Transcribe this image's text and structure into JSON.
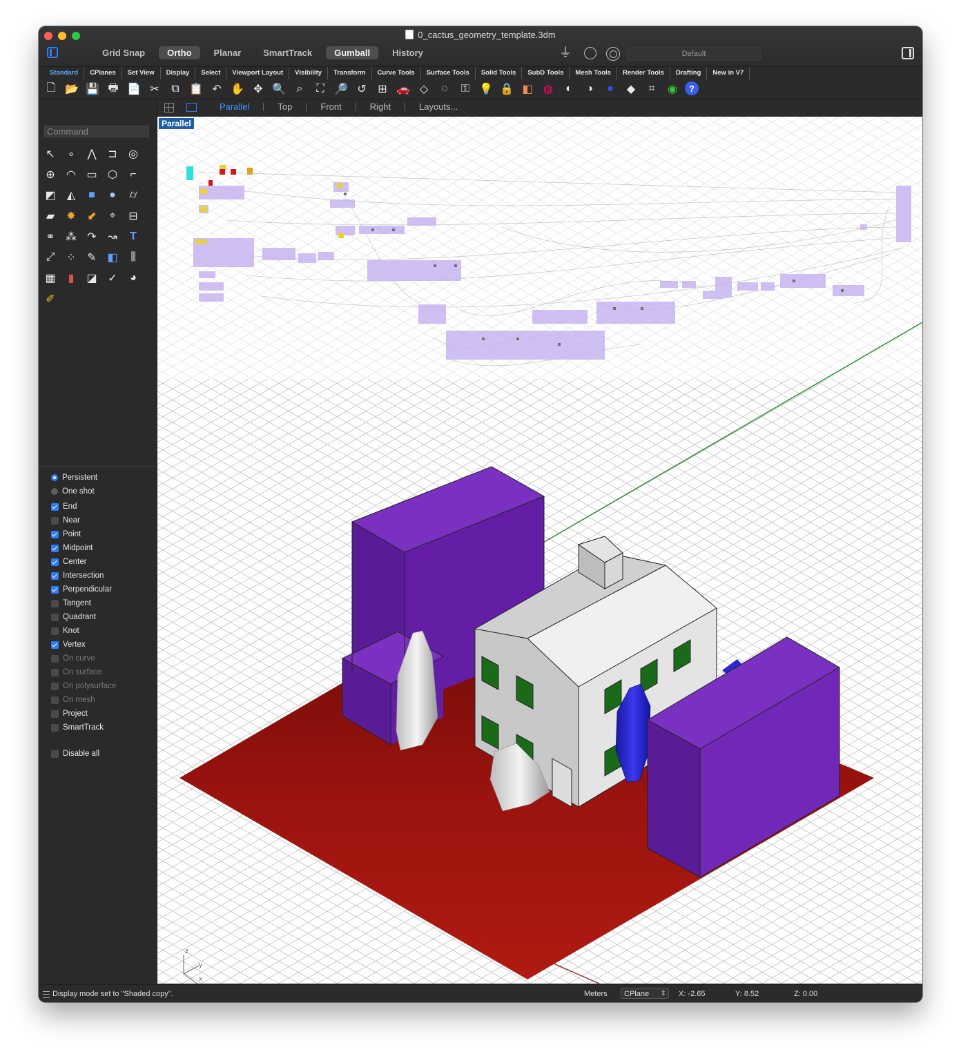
{
  "window": {
    "title": "0_cactus_geometry_template.3dm"
  },
  "modes": [
    {
      "label": "Grid Snap",
      "on": false
    },
    {
      "label": "Ortho",
      "on": true
    },
    {
      "label": "Planar",
      "on": false
    },
    {
      "label": "SmartTrack",
      "on": false
    },
    {
      "label": "Gumball",
      "on": true
    },
    {
      "label": "History",
      "on": false
    }
  ],
  "layer": {
    "current": "Default"
  },
  "tabs": [
    "Standard",
    "CPlanes",
    "Set View",
    "Display",
    "Select",
    "Viewport Layout",
    "Visibility",
    "Transform",
    "Curve Tools",
    "Surface Tools",
    "Solid Tools",
    "SubD Tools",
    "Mesh Tools",
    "Render Tools",
    "Drafting",
    "New in V7"
  ],
  "toolbar_icons": [
    "new-icon",
    "open-icon",
    "save-icon",
    "print-icon",
    "import-icon",
    "cut-icon",
    "copy-icon",
    "paste-icon",
    "undo-icon",
    "pan-icon",
    "rotate-view-icon",
    "zoom-icon",
    "zoom-window-icon",
    "zoom-extents-icon",
    "zoom-selected-icon",
    "undo-view-icon",
    "viewport-4-icon",
    "car-icon",
    "cplane-icon",
    "hide-icon",
    "lock-icon",
    "bulb-icon",
    "padlock-icon",
    "material-icon",
    "color-wheel-icon",
    "wireframe-sphere-icon",
    "shaded-sphere-icon",
    "rendered-sphere-icon",
    "render-icon",
    "grid-options-icon",
    "globe-icon",
    "help-icon"
  ],
  "viewports": {
    "tabs": [
      "Parallel",
      "Top",
      "Front",
      "Right",
      "Layouts..."
    ],
    "active": "Parallel",
    "label": "Parallel"
  },
  "command": {
    "placeholder": "Command"
  },
  "osnap": {
    "modes": [
      {
        "label": "Persistent",
        "selected": true
      },
      {
        "label": "One shot",
        "selected": false
      }
    ],
    "snaps": [
      {
        "label": "End",
        "checked": true,
        "enabled": true
      },
      {
        "label": "Near",
        "checked": false,
        "enabled": true
      },
      {
        "label": "Point",
        "checked": true,
        "enabled": true
      },
      {
        "label": "Midpoint",
        "checked": true,
        "enabled": true
      },
      {
        "label": "Center",
        "checked": true,
        "enabled": true
      },
      {
        "label": "Intersection",
        "checked": true,
        "enabled": true
      },
      {
        "label": "Perpendicular",
        "checked": true,
        "enabled": true
      },
      {
        "label": "Tangent",
        "checked": false,
        "enabled": true
      },
      {
        "label": "Quadrant",
        "checked": false,
        "enabled": true
      },
      {
        "label": "Knot",
        "checked": false,
        "enabled": true
      },
      {
        "label": "Vertex",
        "checked": true,
        "enabled": true
      },
      {
        "label": "On curve",
        "checked": false,
        "enabled": false
      },
      {
        "label": "On surface",
        "checked": false,
        "enabled": false
      },
      {
        "label": "On polysurface",
        "checked": false,
        "enabled": false
      },
      {
        "label": "On mesh",
        "checked": false,
        "enabled": false
      },
      {
        "label": "Project",
        "checked": false,
        "enabled": true
      },
      {
        "label": "SmartTrack",
        "checked": false,
        "enabled": true
      }
    ],
    "disable_all": "Disable all"
  },
  "status": {
    "message": "Display mode set to \"Shaded copy\".",
    "units": "Meters",
    "cplane": "CPlane",
    "x": "X: -2.65",
    "y": "Y: 8.52",
    "z": "Z: 0.00"
  },
  "axes": {
    "x": "x",
    "y": "y",
    "z": "z"
  },
  "colors": {
    "accent": "#2f7cf6",
    "ground": "#a6140f",
    "building": "#7028b0",
    "house": "#dedede",
    "cactus_blue": "#2a28d0"
  }
}
